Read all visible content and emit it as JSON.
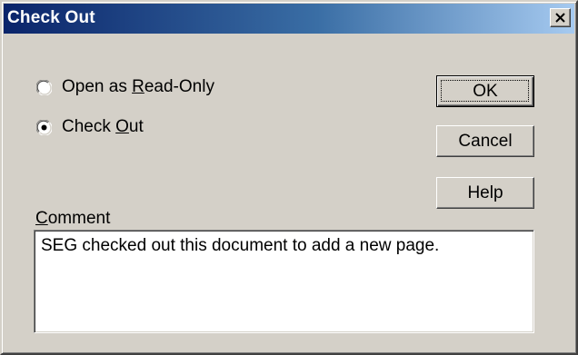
{
  "window": {
    "title": "Check Out"
  },
  "options": [
    {
      "label_before": "Open as ",
      "mnemonic": "R",
      "label_after": "ead-Only",
      "selected": false
    },
    {
      "label_before": "Check ",
      "mnemonic": "O",
      "label_after": "ut",
      "selected": true
    }
  ],
  "buttons": {
    "ok": "OK",
    "cancel": "Cancel",
    "help": "Help"
  },
  "comment": {
    "label_mnemonic": "C",
    "label_rest": "omment",
    "value": "SEG checked out this document to add a new page."
  },
  "icons": {
    "close": "close-icon",
    "radio": "radio-button-icon"
  }
}
